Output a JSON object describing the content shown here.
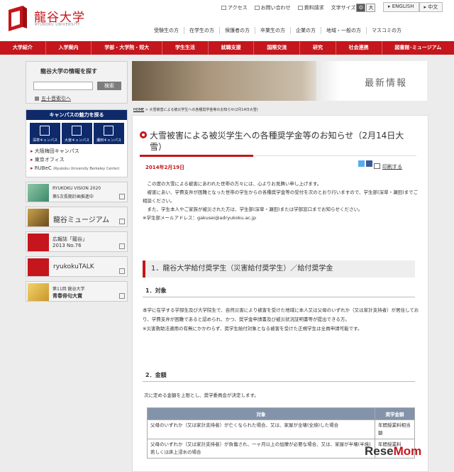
{
  "header": {
    "logo_title": "龍谷大学",
    "logo_sub": "RYUKOKU UNIVERSITY",
    "util": [
      "アクセス",
      "お問い合わせ",
      "資料請求"
    ],
    "font_size_label": "文字サイズ",
    "font_sizes": [
      "中",
      "大"
    ],
    "langs": [
      "▸ ENGLISH",
      "▸ 中文"
    ],
    "audience": [
      "受験生の方",
      "在学生の方",
      "保護者の方",
      "卒業生の方",
      "企業の方",
      "地域・一般の方",
      "マスコミの方"
    ]
  },
  "nav": [
    "大学紹介",
    "入学案内",
    "学部・大学院・短大",
    "学生生活",
    "就職支援",
    "国際交流",
    "研究",
    "社会連携",
    "図書館･ミュージアム"
  ],
  "sidebar": {
    "search_title": "龍谷大学の情報を探す",
    "search_button": "検索",
    "index_link": "五十音索引へ",
    "campus_title": "キャンパスの魅力を探る",
    "campus_icons": [
      "深草キャンパス",
      "大宮キャンパス",
      "瀬田キャンパス"
    ],
    "campus_list": [
      "大阪梅田キャンパス",
      "東京オフィス",
      "RUBeC"
    ],
    "rubec_sub": "(Ryukoku University Berkeley Center)",
    "banners": [
      {
        "t1": "RYUKOKU VISION 2020",
        "t2": "第5次長期計画推進中"
      },
      {
        "big": "龍谷ミュージアム"
      },
      {
        "t1": "広報誌「龍谷」",
        "t2": "2013 No.76"
      },
      {
        "big": "ryukokuTALK"
      },
      {
        "t1": "第11回 龍谷大学",
        "t2": "青春俳句大賞"
      }
    ]
  },
  "hero": {
    "title": "最新情報"
  },
  "breadcrumb": {
    "home": "HOME",
    "current": " > 大雪被害による被災学生への各種奨学金等のお知らせ(2月14日大雪)"
  },
  "article": {
    "title": "大雪被害による被災学生への各種奨学金等のお知らせ（2月14日大雪）",
    "date": "2014年2月19日",
    "print": "印刷する",
    "intro": [
      "　この度の大雪による被害にあわれた世帯の方々には、心よりお見舞い申し上げます。",
      "　被害にあい、学費支弁が困難となった世帯の学生からの各種奨学金等の受付を次のとおり行いますので、学生部(深草・瀬田)までご相談ください。",
      "　また、学生本人やご家族が被災された方は、学生部(深草・瀬田)または学部窓口までお知らせください。",
      "※学生部メールアドレス：gakusei@adryukoku.ac.jp"
    ],
    "section1": "1．龍谷大学給付奨学生（災害給付奨学生）／給付奨学金",
    "sub1": "1．対象",
    "p1": [
      "本学に在学する学部生及び大学院生で、自然災害により被害を受けた地域に本人又は父母のいずれか（又は家計支持者）が居住しており、学費支弁が困難であると認められ、かつ、奨学金申請書及び被災状況証明書等が提出できる方。",
      "※災害救助法適用の有無にかかわらず、奨学生給付対象となる被害を受けた正規学生は全員申請可能です。"
    ],
    "sub2": "2．金額",
    "p2": "次に定める金額を上限とし、奨学委員会が決定します。",
    "table": {
      "headers": [
        "対象",
        "奨学金額"
      ],
      "rows": [
        [
          "父母のいずれか（又は家計支持者）が亡くなられた場合、又は、家屋が全壊(全焼)した場合",
          "年間授業料相当額"
        ],
        [
          "父母のいずれか（又は家計支持者）が負傷され、一ヶ月以上の加療が必要な場合、又は、家屋が半壊(半焼)若しくは床上浸水の場合",
          "年間授業料"
        ]
      ]
    }
  },
  "watermark": {
    "a": "Rese",
    "b": "Mom"
  },
  "colors": {
    "brand": "#c4161c",
    "navy": "#0e2a6b",
    "table_head": "#8393aa"
  }
}
